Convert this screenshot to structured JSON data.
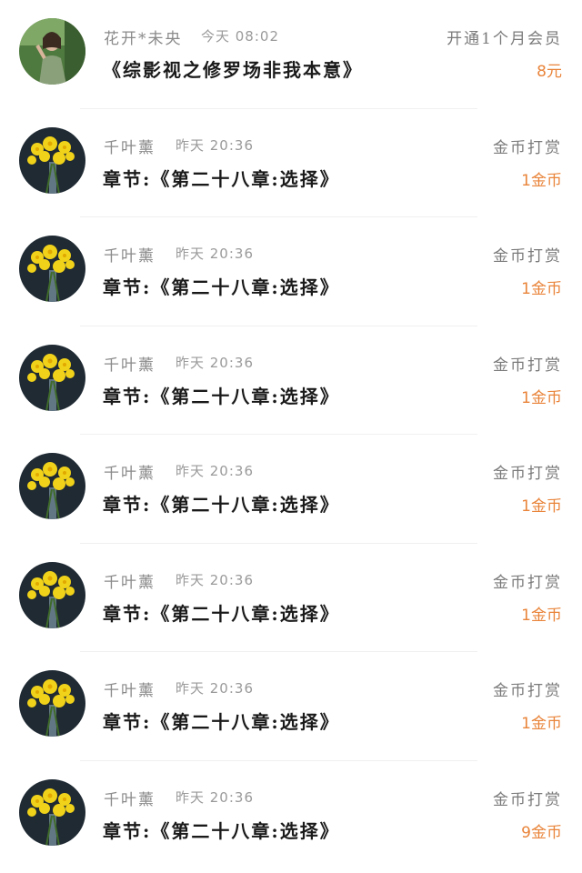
{
  "items": [
    {
      "name": "花开*未央",
      "time": "今天 08:02",
      "title": "《综影视之修罗场非我本意》",
      "action": "开通1个月会员",
      "amount": "8元",
      "avatar": "girl-photo"
    },
    {
      "name": "千叶薰",
      "time": "昨天 20:36",
      "title": "章节:《第二十八章:选择》",
      "action": "金币打赏",
      "amount": "1金币",
      "avatar": "yellow-flowers-photo"
    },
    {
      "name": "千叶薰",
      "time": "昨天 20:36",
      "title": "章节:《第二十八章:选择》",
      "action": "金币打赏",
      "amount": "1金币",
      "avatar": "yellow-flowers-photo"
    },
    {
      "name": "千叶薰",
      "time": "昨天 20:36",
      "title": "章节:《第二十八章:选择》",
      "action": "金币打赏",
      "amount": "1金币",
      "avatar": "yellow-flowers-photo"
    },
    {
      "name": "千叶薰",
      "time": "昨天 20:36",
      "title": "章节:《第二十八章:选择》",
      "action": "金币打赏",
      "amount": "1金币",
      "avatar": "yellow-flowers-photo"
    },
    {
      "name": "千叶薰",
      "time": "昨天 20:36",
      "title": "章节:《第二十八章:选择》",
      "action": "金币打赏",
      "amount": "1金币",
      "avatar": "yellow-flowers-photo"
    },
    {
      "name": "千叶薰",
      "time": "昨天 20:36",
      "title": "章节:《第二十八章:选择》",
      "action": "金币打赏",
      "amount": "1金币",
      "avatar": "yellow-flowers-photo"
    },
    {
      "name": "千叶薰",
      "time": "昨天 20:36",
      "title": "章节:《第二十八章:选择》",
      "action": "金币打赏",
      "amount": "9金币",
      "avatar": "yellow-flowers-photo"
    }
  ],
  "colors": {
    "amount": "#e9843a",
    "name": "#8a8a8a",
    "title": "#1a1a1a"
  }
}
